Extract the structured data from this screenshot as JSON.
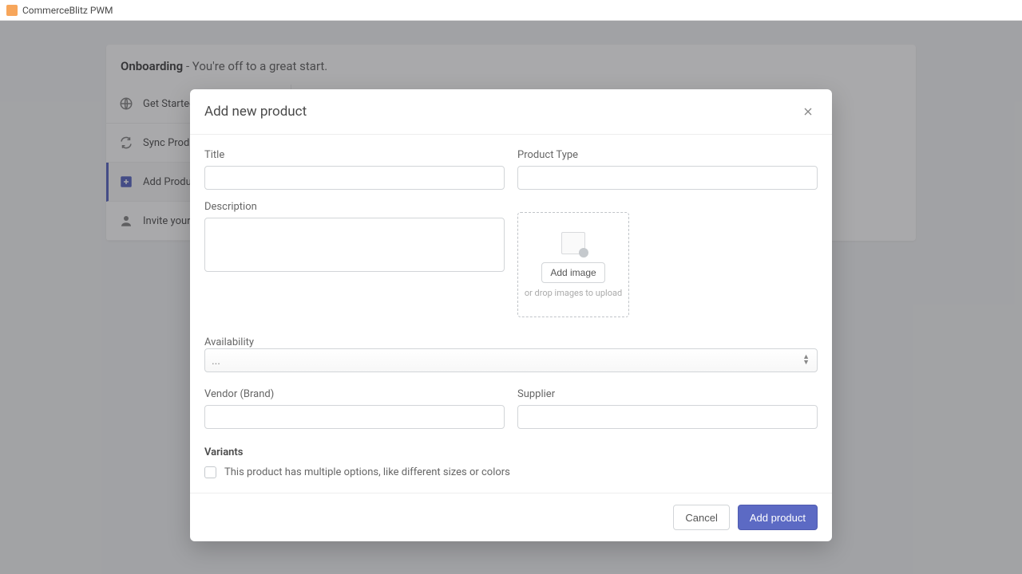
{
  "app": {
    "title": "CommerceBlitz PWM"
  },
  "onboarding": {
    "title": "Onboarding",
    "subtitle": " - You're off to a great start."
  },
  "sidebar": {
    "items": [
      {
        "label": "Get Started"
      },
      {
        "label": "Sync Products from"
      },
      {
        "label": "Add Products Man"
      },
      {
        "label": "Invite your buyers"
      }
    ]
  },
  "modal": {
    "title": "Add new product",
    "labels": {
      "title": "Title",
      "product_type": "Product Type",
      "description": "Description",
      "add_image": "Add image",
      "drop_hint": "or drop images to upload",
      "availability": "Availability",
      "availability_value": "...",
      "vendor": "Vendor (Brand)",
      "supplier": "Supplier",
      "variants": "Variants",
      "variants_checkbox": "This product has multiple options, like different sizes or colors"
    },
    "buttons": {
      "cancel": "Cancel",
      "add_product": "Add product"
    }
  }
}
